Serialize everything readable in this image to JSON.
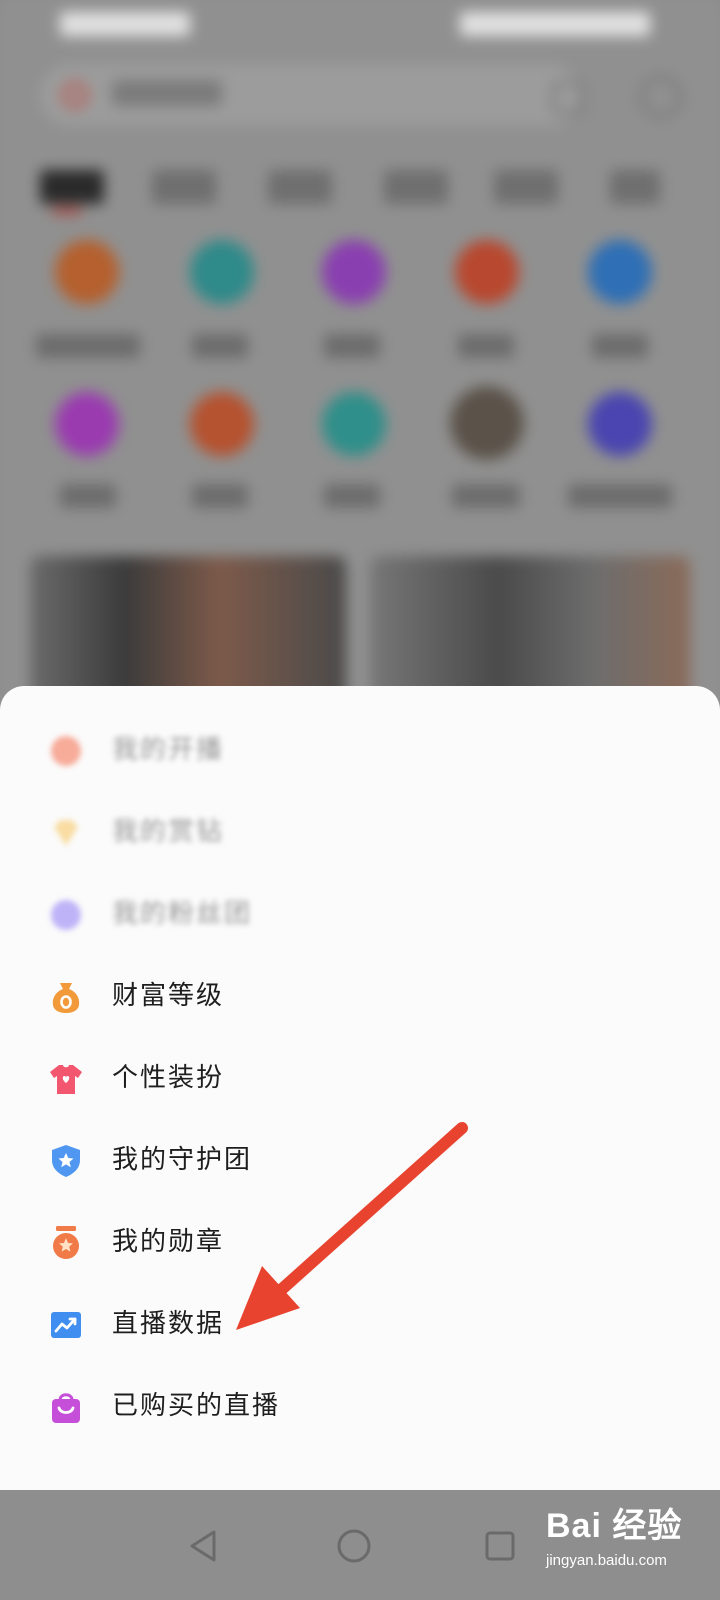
{
  "menu": {
    "items": [
      {
        "label": "我的开播",
        "icon": "broadcast-icon",
        "color": "#f46a4a"
      },
      {
        "label": "我的赏钻",
        "icon": "diamond-icon",
        "color": "#f7c45a"
      },
      {
        "label": "我的粉丝团",
        "icon": "fan-club-icon",
        "color": "#8f79f5"
      },
      {
        "label": "财富等级",
        "icon": "money-bag-icon",
        "color": "#f29a3a"
      },
      {
        "label": "个性装扮",
        "icon": "tshirt-icon",
        "color": "#f2576f"
      },
      {
        "label": "我的守护团",
        "icon": "shield-star-icon",
        "color": "#4f97f0"
      },
      {
        "label": "我的勋章",
        "icon": "medal-icon",
        "color": "#f07a48"
      },
      {
        "label": "直播数据",
        "icon": "chart-trend-icon",
        "color": "#3f8ef0"
      },
      {
        "label": "已购买的直播",
        "icon": "shopping-bag-icon",
        "color": "#c64fd9"
      }
    ]
  },
  "navbar": {
    "back": "back-triangle-icon",
    "home": "home-circle-icon",
    "recent": "recent-square-icon"
  },
  "annotation": {
    "color": "#e8432f"
  },
  "watermark": {
    "brand": "Bai 经验",
    "url": "jingyan.baidu.com"
  }
}
